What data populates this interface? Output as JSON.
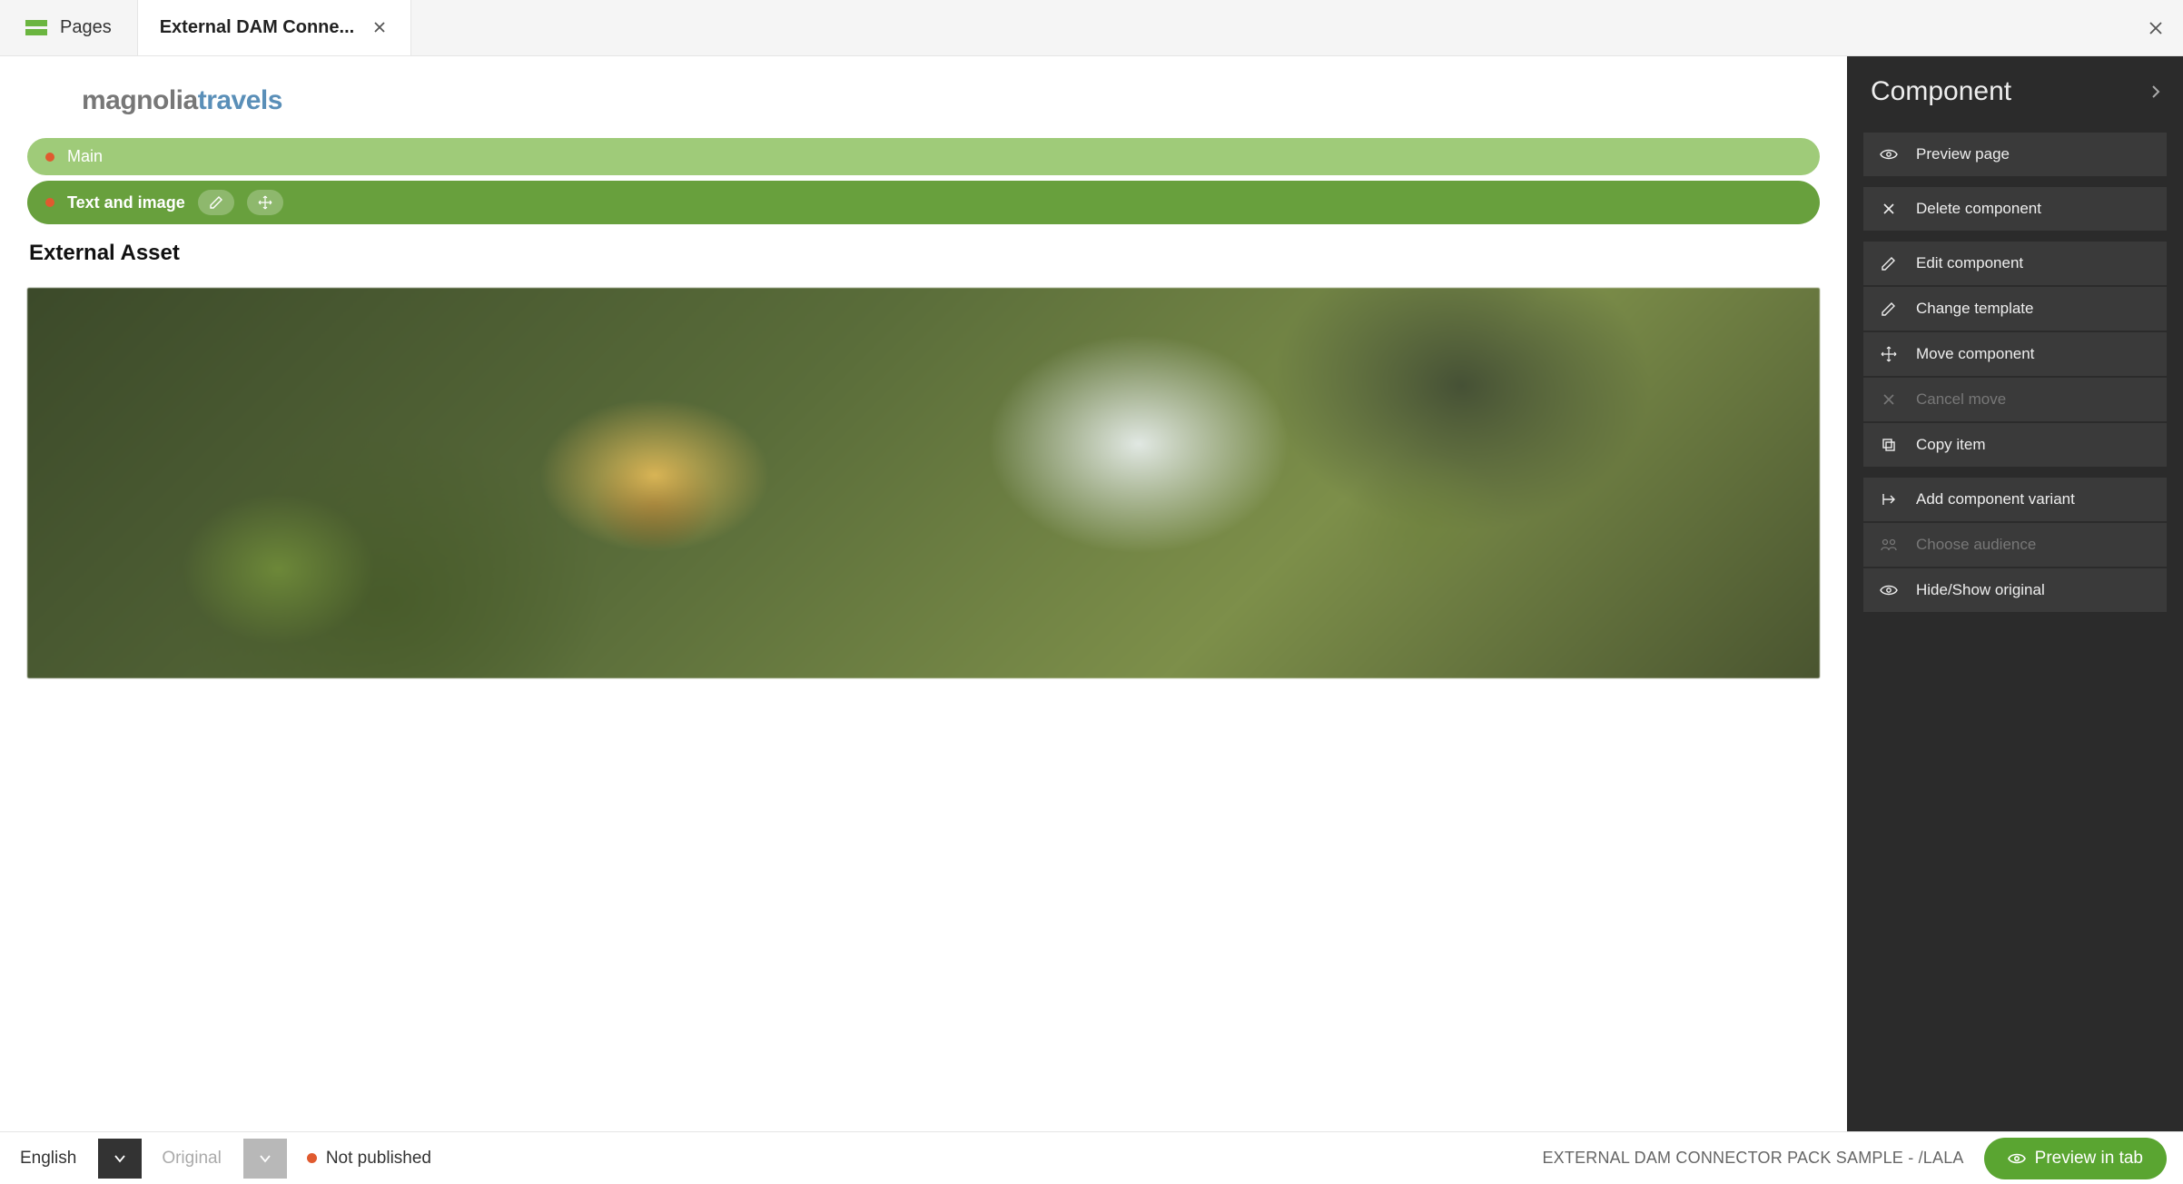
{
  "tabs": {
    "pages": "Pages",
    "active": "External DAM Conne..."
  },
  "site": {
    "logo_a": "magnolia",
    "logo_b": "travels"
  },
  "editor": {
    "area_label": "Main",
    "component_label": "Text and image",
    "content_heading": "External Asset"
  },
  "panel": {
    "title": "Component",
    "actions": {
      "preview_page": "Preview page",
      "delete_component": "Delete component",
      "edit_component": "Edit component",
      "change_template": "Change template",
      "move_component": "Move component",
      "cancel_move": "Cancel move",
      "copy_item": "Copy item",
      "add_variant": "Add component variant",
      "choose_audience": "Choose audience",
      "hide_show_original": "Hide/Show original"
    }
  },
  "footer": {
    "language": "English",
    "variant": "Original",
    "status": "Not published",
    "breadcrumb": "EXTERNAL DAM CONNECTOR PACK SAMPLE - /lala",
    "preview_btn": "Preview in tab"
  }
}
